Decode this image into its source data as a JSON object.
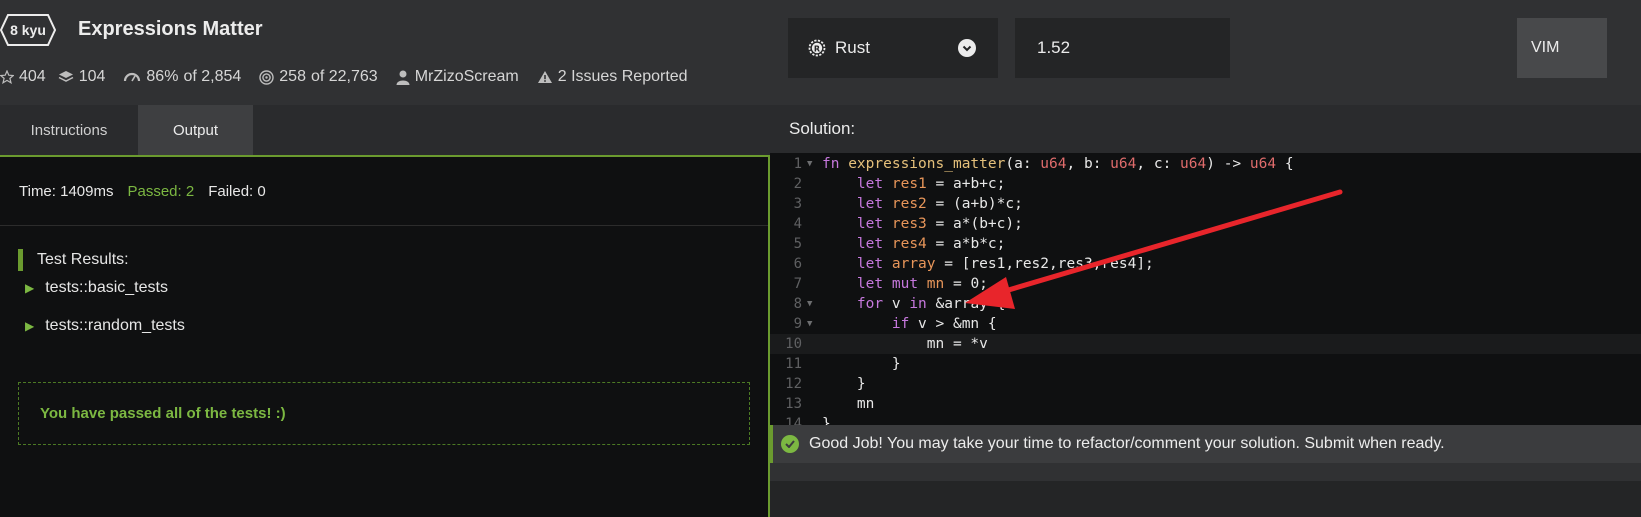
{
  "kata": {
    "rank": "8 kyu",
    "title": "Expressions Matter",
    "stats": {
      "stars": "404",
      "collections": "104",
      "satisfaction": "86%",
      "satisfaction_of": "of 2,854",
      "completed": "258",
      "completed_of": "of 22,763",
      "author": "MrZizoScream",
      "issues": "2 Issues Reported"
    }
  },
  "tabs": [
    {
      "label": "Instructions",
      "active": false
    },
    {
      "label": "Output",
      "active": true
    }
  ],
  "output": {
    "time": "Time: 1409ms",
    "passed": "Passed: 2",
    "failed": "Failed: 0",
    "results_title": "Test Results:",
    "tests": [
      "tests::basic_tests",
      "tests::random_tests"
    ],
    "pass_message": "You have passed all of the tests! :)"
  },
  "editor_controls": {
    "language": "Rust",
    "version": "1.52",
    "vim_label": "VIM"
  },
  "solution": {
    "title": "Solution:",
    "active_line": 10,
    "code_lines": [
      "fn expressions_matter(a: u64, b: u64, c: u64) -> u64 {",
      "    let res1 = a+b+c;",
      "    let res2 = (a+b)*c;",
      "    let res3 = a*(b+c);",
      "    let res4 = a*b*c;",
      "    let array = [res1,res2,res3,res4];",
      "    let mut mn = 0;",
      "    for v in &array {",
      "        if v > &mn {",
      "            mn = *v",
      "        }",
      "    }",
      "    mn",
      "}"
    ],
    "folded_lines": [
      1,
      8,
      9
    ]
  },
  "status_message": "Good Job! You may take your time to refactor/comment your solution. Submit when ready.",
  "colors": {
    "accent_green": "#7cb842",
    "annotation_red": "#e8252b",
    "keyword": "#c678dd",
    "type": "#e06c6c"
  }
}
